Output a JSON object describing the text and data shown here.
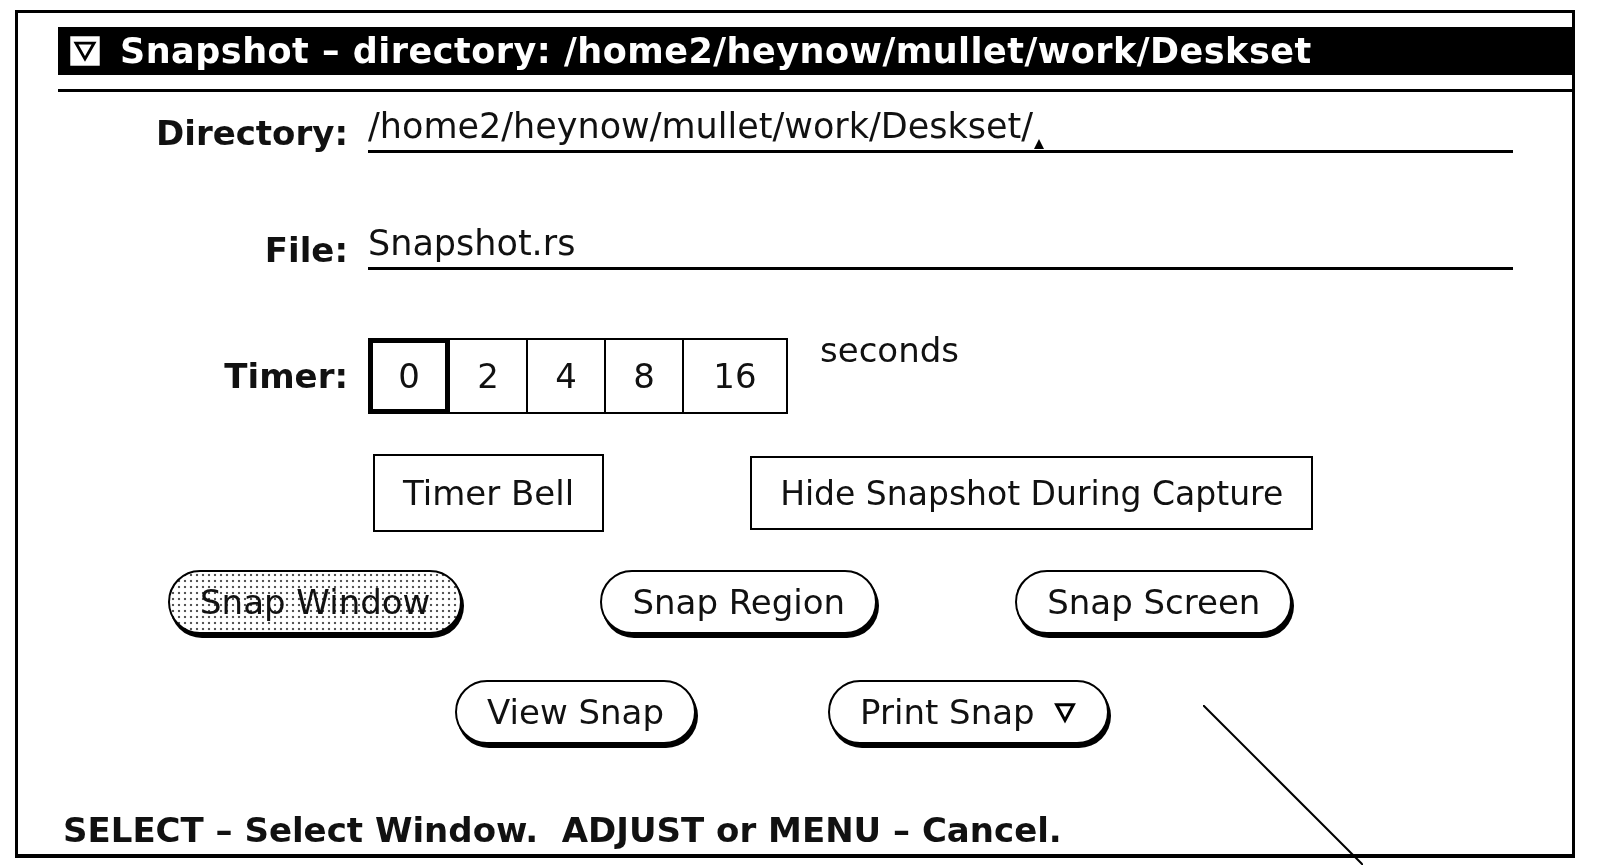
{
  "window": {
    "title": "Snapshot – directory: /home2/heynow/mullet/work/Deskset"
  },
  "fields": [
    {
      "label": "Directory:",
      "value": "/home2/heynow/mullet/work/Deskset/",
      "focused": true
    },
    {
      "label": "File:",
      "value": "Snapshot.rs",
      "focused": false
    }
  ],
  "timer": {
    "label": "Timer:",
    "unit": "seconds",
    "options": [
      {
        "label": "0",
        "selected": true
      },
      {
        "label": "2",
        "selected": false
      },
      {
        "label": "4",
        "selected": false
      },
      {
        "label": "8",
        "selected": false
      },
      {
        "label": "16",
        "selected": false
      }
    ]
  },
  "toggles": [
    {
      "label": "Timer Bell",
      "checked": false
    },
    {
      "label": "Hide Snapshot During Capture",
      "checked": false
    }
  ],
  "button_rows": [
    [
      {
        "label": "Snap Window",
        "busy": true,
        "menu": false
      },
      {
        "label": "Snap Region",
        "busy": false,
        "menu": false
      },
      {
        "label": "Snap Screen",
        "busy": false,
        "menu": false
      }
    ],
    [
      {
        "label": "View Snap",
        "busy": false,
        "menu": false
      },
      {
        "label": "Print Snap",
        "busy": false,
        "menu": true
      }
    ]
  ],
  "status": "SELECT – Select Window.  ADJUST or MENU – Cancel."
}
